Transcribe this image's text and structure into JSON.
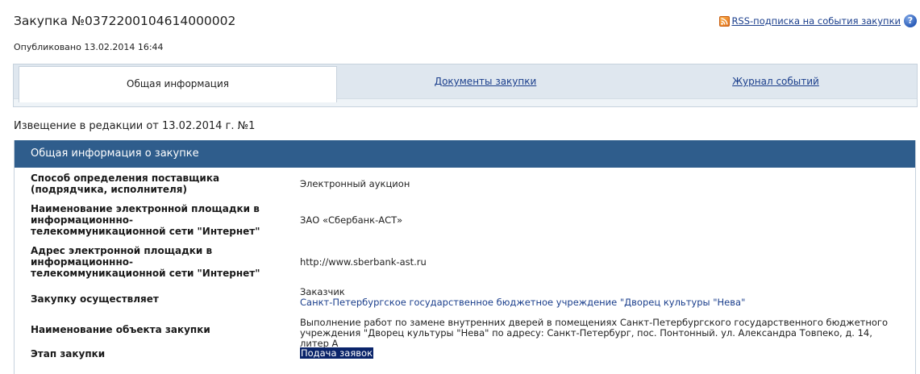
{
  "header": {
    "title": "Закупка №0372200104614000002",
    "published": "Опубликовано 13.02.2014 16:44",
    "rss_link": "RSS-подписка на события закупки",
    "help_glyph": "?"
  },
  "tabs": [
    {
      "label": "Общая информация",
      "active": true
    },
    {
      "label": "Документы закупки",
      "active": false
    },
    {
      "label": "Журнал событий",
      "active": false
    }
  ],
  "notice": "Извещение в редакции от 13.02.2014 г. №1",
  "panel": {
    "title": "Общая информация о закупке",
    "rows": [
      {
        "label": "Способ определения поставщика (подрядчика, исполнителя)",
        "value": "Электронный аукцион"
      },
      {
        "label": "Наименование электронной площадки в информационнно-телекоммуникационной сети \"Интернет\"",
        "value": "ЗАО «Сбербанк-АСТ»"
      },
      {
        "label": "Адрес электронной площадки в информационнно-телекоммуникационной сети \"Интернет\"",
        "value": "http://www.sberbank-ast.ru"
      },
      {
        "label": "Закупку осуществляет",
        "value_role": "Заказчик",
        "value": "Санкт-Петербургское государственное бюджетное учреждение \"Дворец культуры \"Нева\""
      },
      {
        "label": "Наименование объекта закупки",
        "value": "Выполнение работ по замене внутренних дверей в помещениях Санкт-Петербургского государственного бюджетного учреждения \"Дворец культуры \"Нева\" по адресу: Санкт-Петербург, пос. Понтонный. ул. Александра Товпеко, д. 14, литер А"
      },
      {
        "label": "Этап закупки",
        "value": "Подача заявок"
      }
    ]
  },
  "colors": {
    "panel_header": "#2f5d8c",
    "link": "#1a3e8c",
    "selection": "#0a246a"
  }
}
